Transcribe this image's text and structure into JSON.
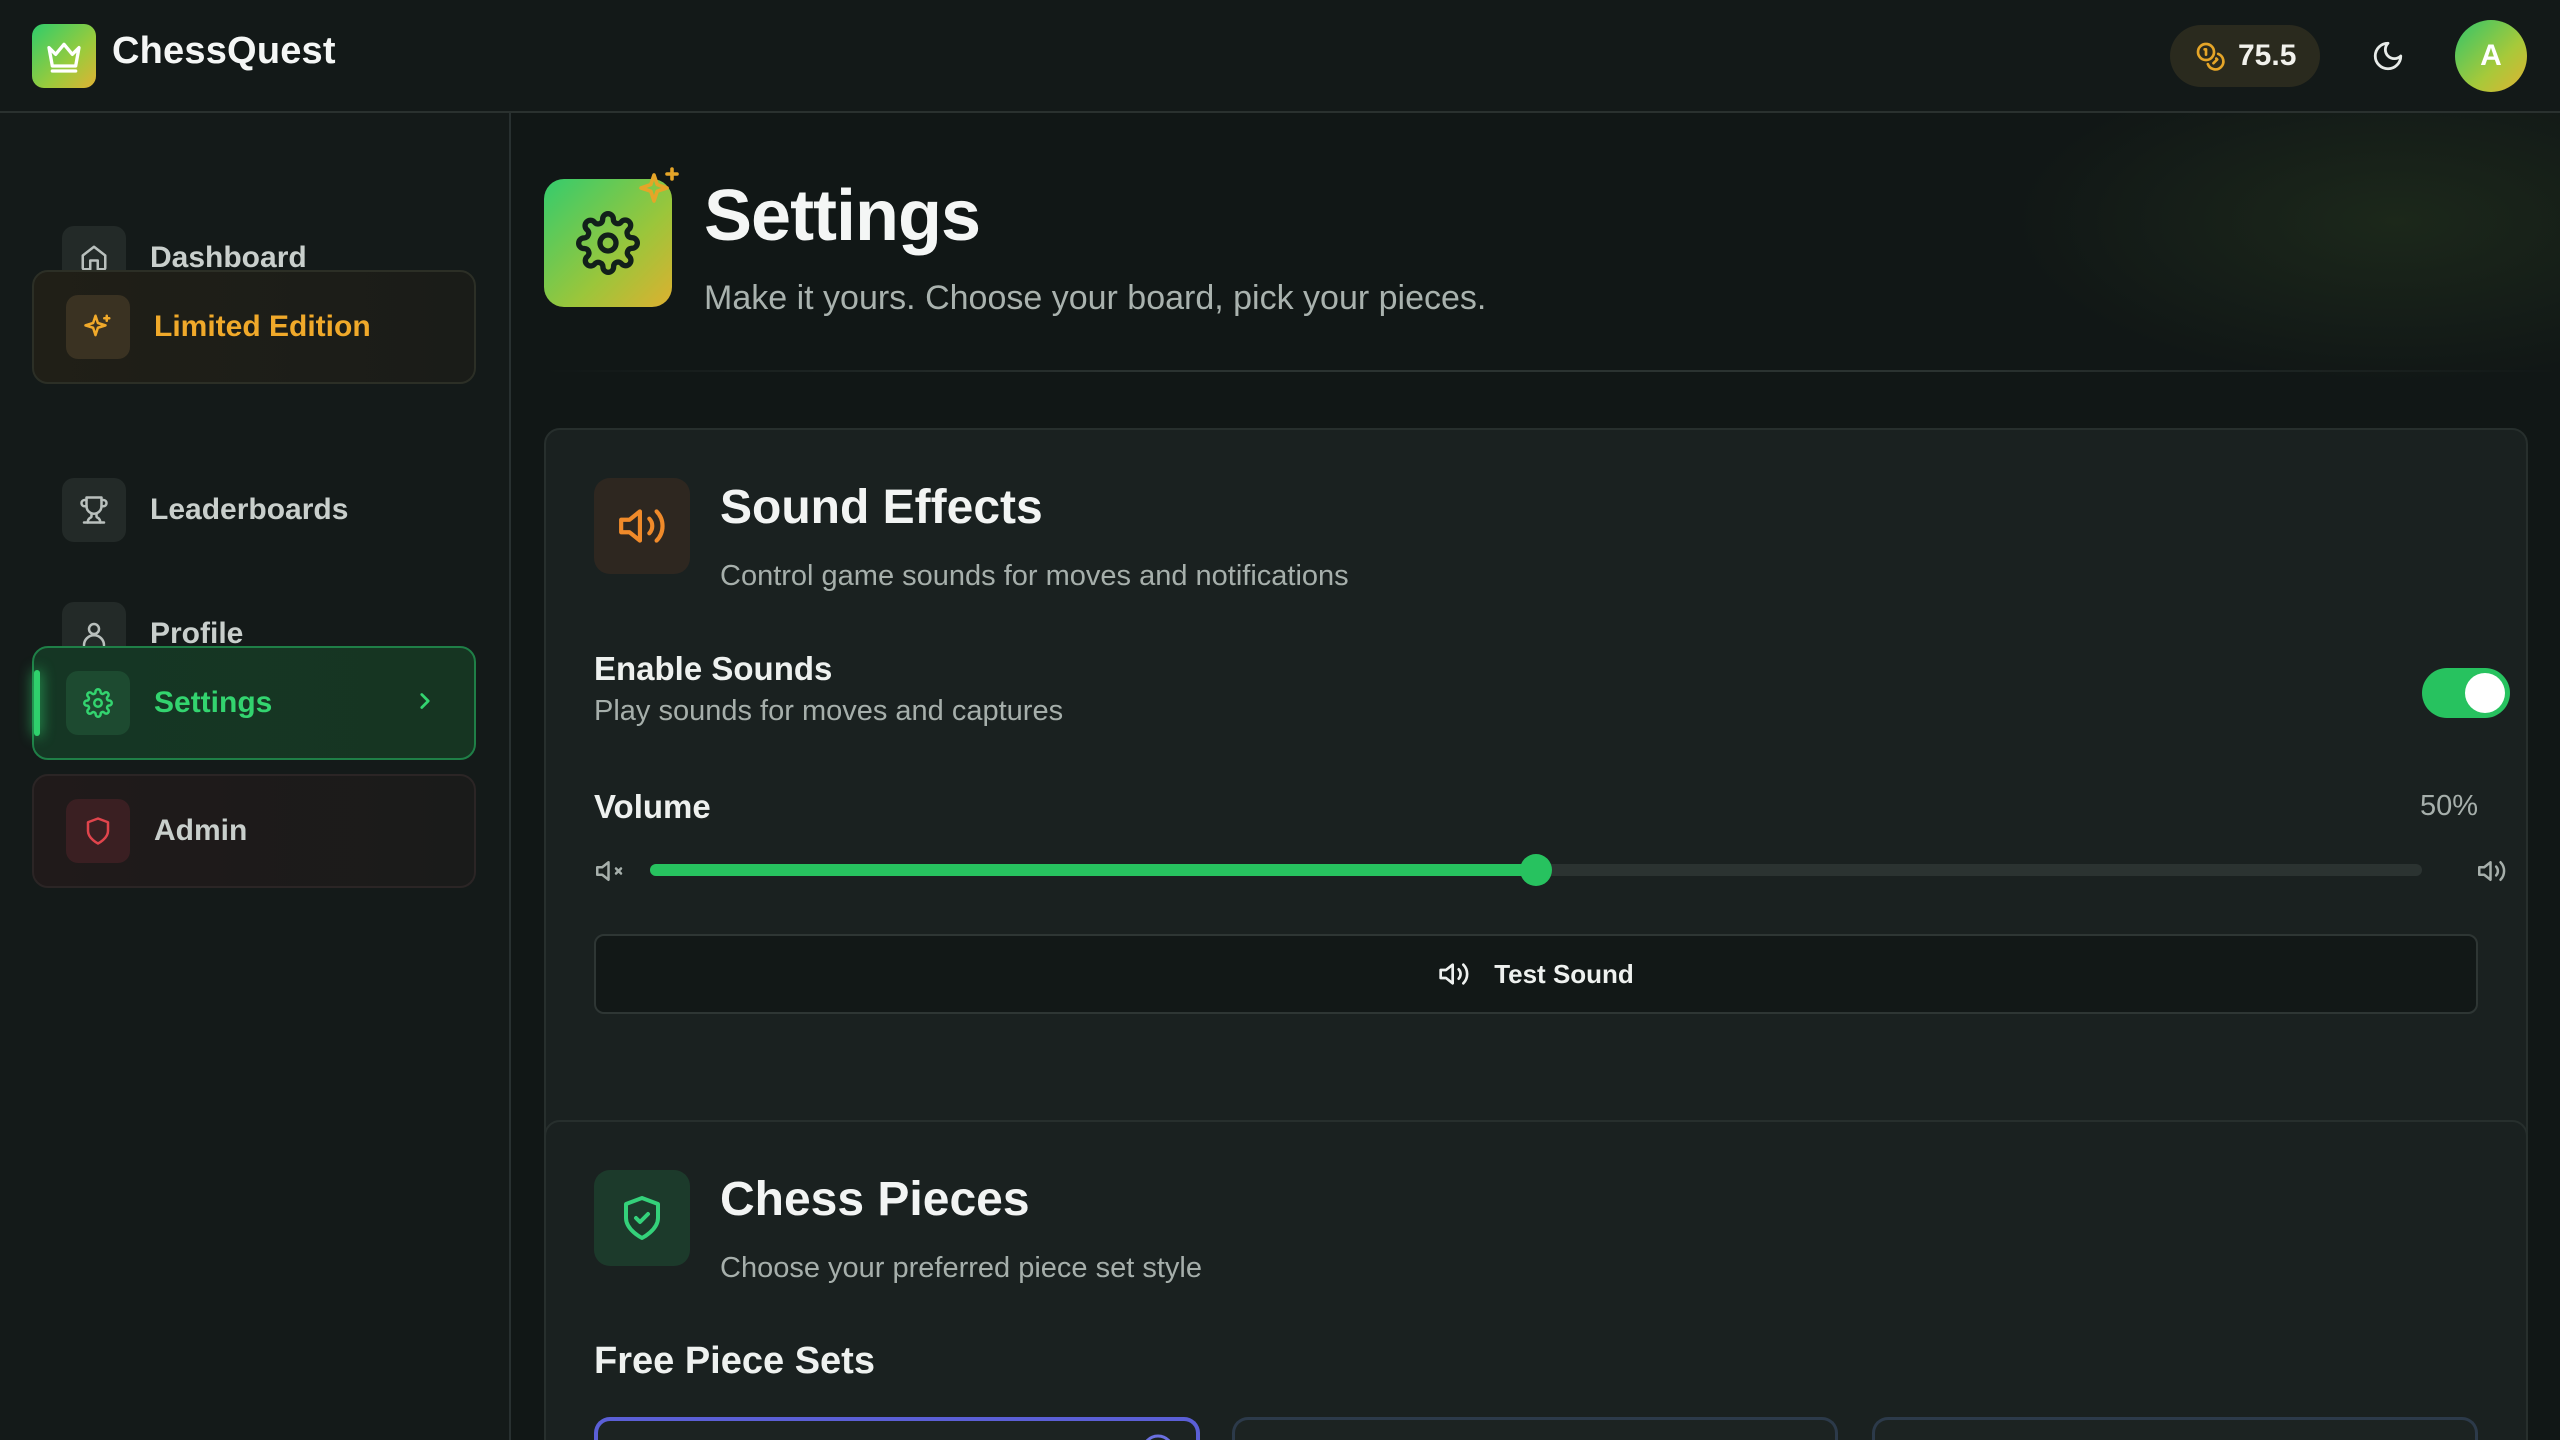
{
  "app": {
    "name": "ChessQuest"
  },
  "header": {
    "coins": "75.5",
    "avatar_initial": "A"
  },
  "sidebar": {
    "items": [
      {
        "label": "Dashboard",
        "icon": "home-icon"
      },
      {
        "label": "Limited Edition",
        "icon": "sparkles-icon"
      },
      {
        "label": "Leaderboards",
        "icon": "trophy-icon"
      },
      {
        "label": "Profile",
        "icon": "user-icon"
      },
      {
        "label": "Settings",
        "icon": "gear-icon",
        "active": true
      },
      {
        "label": "Admin",
        "icon": "shield-icon"
      }
    ]
  },
  "page": {
    "title": "Settings",
    "subtitle": "Make it yours. Choose your board, pick your pieces."
  },
  "sound": {
    "title": "Sound Effects",
    "description": "Control game sounds for moves and notifications",
    "enable_title": "Enable Sounds",
    "enable_sub": "Play sounds for moves and captures",
    "enabled": true,
    "volume_label": "Volume",
    "volume_value": "50%",
    "volume_fraction": 0.5,
    "test_label": "Test Sound"
  },
  "pieces": {
    "title": "Chess Pieces",
    "description": "Choose your preferred piece set style",
    "free_heading": "Free Piece Sets"
  },
  "colors": {
    "accent_green": "#27c25f",
    "accent_gold": "#f0a92a",
    "admin_red": "#e0444c",
    "background": "#111716"
  }
}
